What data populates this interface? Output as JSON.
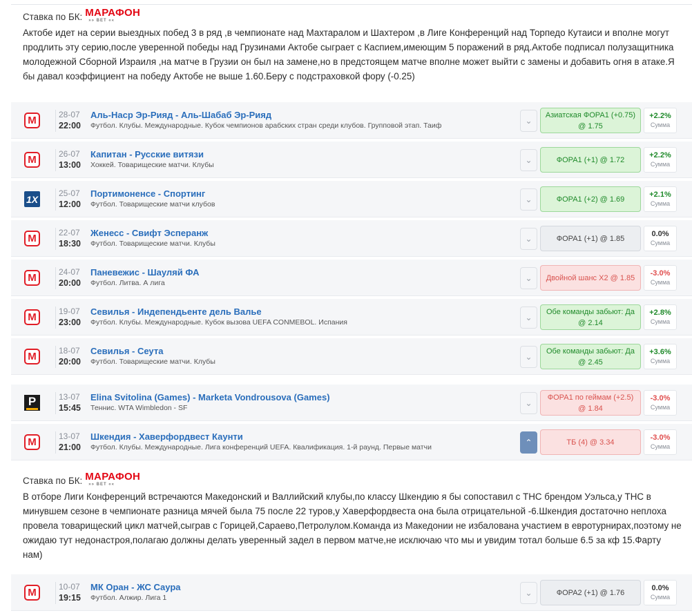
{
  "bookmaker_logo": {
    "line1": "МАРАФОН",
    "line2": "»» BET ««"
  },
  "notes": [
    {
      "prefix": "Ставка по БК:",
      "text": "Актобе идет на серии выездных побед 3 в ряд ,в чемпионате над Махтаралом и Шахтером ,в Лиге Конференций над Торпедо Кутаиси и вполне могут продлить эту серию,после уверенной победы над Грузинами Актобе сыграет с Каспием,имеющим 5 поражений в ряд.Актобе подписал полузащитника молодежной Сборной Израиля ,на матче в Грузии он был на замене,но в предстоящем матче вполне может выйти с замены и добавить огня в атаке.Я бы давал коэффициент на победу Актобе не выше 1.60.Беру с подстраховкой фору (-0.25)"
    },
    {
      "prefix": "Ставка по БК:",
      "text": "В отборе Лиги Конференций встречаются Македонский и Валлийский клубы,по классу Шкендию я бы сопоставил с ТНС брендом Уэльса,у ТНС в минувшем сезоне в чемпионате разница мячей была 75 после 22 туров,у Хаверфордвеста она была отрицательной -6.Шкендия достаточно неплоха провела товарищеский цикл матчей,сыграв с Горицей,Сараево,Петролулом.Команда из Македонии не избалована участием в евротурнирах,поэтому не ожидаю тут недонастроя,полагаю должны делать уверенный задел в первом матче,не исключаю что мы и увидим тотал больше 6.5 за кф 15.Фарту нам)"
    }
  ],
  "sum_label": "Сумма",
  "bets": [
    {
      "logo": "M",
      "date": "28-07",
      "time": "22:00",
      "match": "Аль-Наср Эр-Рияд - Аль-Шабаб Эр-Рияд",
      "league": "Футбол. Клубы. Международные. Кубок чемпионов арабских стран среди клубов. Групповой этап. Таиф",
      "pick": "Азиатская ФОРА1 (+0.75) @ 1.75",
      "result": "+2.2%",
      "status": "win"
    },
    {
      "logo": "M",
      "date": "26-07",
      "time": "13:00",
      "match": "Капитан - Русские витязи",
      "league": "Хоккей. Товарищеские матчи. Клубы",
      "pick": "ФОРА1 (+1) @ 1.72",
      "result": "+2.2%",
      "status": "win"
    },
    {
      "logo": "1X",
      "date": "25-07",
      "time": "12:00",
      "match": "Портимоненсе - Спортинг",
      "league": "Футбол. Товарищеские матчи клубов",
      "pick": "ФОРА1 (+2) @ 1.69",
      "result": "+2.1%",
      "status": "win"
    },
    {
      "logo": "M",
      "date": "22-07",
      "time": "18:30",
      "match": "Женесс - Свифт Эсперанж",
      "league": "Футбол. Товарищеские матчи. Клубы",
      "pick": "ФОРА1 (+1) @ 1.85",
      "result": "0.0%",
      "status": "push"
    },
    {
      "logo": "M",
      "date": "24-07",
      "time": "20:00",
      "match": "Паневежис - Шауляй ФА",
      "league": "Футбол. Литва. А лига",
      "pick": "Двойной шанс X2 @ 1.85",
      "result": "-3.0%",
      "status": "loss"
    },
    {
      "logo": "M",
      "date": "19-07",
      "time": "23:00",
      "match": "Севилья - Индепендьенте дель Валье",
      "league": "Футбол. Клубы. Международные. Кубок вызова UEFA CONMEBOL. Испания",
      "pick": "Обе команды забьют: Да @ 2.14",
      "result": "+2.8%",
      "status": "win"
    },
    {
      "logo": "M",
      "date": "18-07",
      "time": "20:00",
      "match": "Севилья - Сеута",
      "league": "Футбол. Товарищеские матчи. Клубы",
      "pick": "Обе команды забьют: Да @ 2.45",
      "result": "+3.6%",
      "status": "win"
    },
    {
      "logo": "P",
      "date": "13-07",
      "time": "15:45",
      "match": "Elina Svitolina (Games) - Marketa Vondrousova (Games)",
      "league": "Теннис. WTA Wimbledon - SF",
      "pick": "ФОРА1 по геймам (+2.5) @ 1.84",
      "result": "-3.0%",
      "status": "loss"
    },
    {
      "logo": "M",
      "date": "13-07",
      "time": "21:00",
      "match": "Шкендия - Хаверфордвест Каунти",
      "league": "Футбол. Клубы. Международные. Лига конференций UEFA. Квалификация. 1-й раунд. Первые матчи",
      "pick": "ТБ (4) @ 3.34",
      "result": "-3.0%",
      "status": "loss",
      "expanded": true
    },
    {
      "logo": "M",
      "date": "10-07",
      "time": "19:15",
      "match": "МК Оран - ЖС Саура",
      "league": "Футбол. Алжир. Лига 1",
      "pick": "ФОРА2 (+1) @ 1.76",
      "result": "0.0%",
      "status": "push"
    }
  ],
  "icons": {
    "collapsed": "chevron-down-icon",
    "expanded": "chevron-up-icon"
  },
  "colors": {
    "win": "#1f8a2a",
    "loss": "#d9534f",
    "brand": "#e30613",
    "link": "#2a6ebb"
  }
}
